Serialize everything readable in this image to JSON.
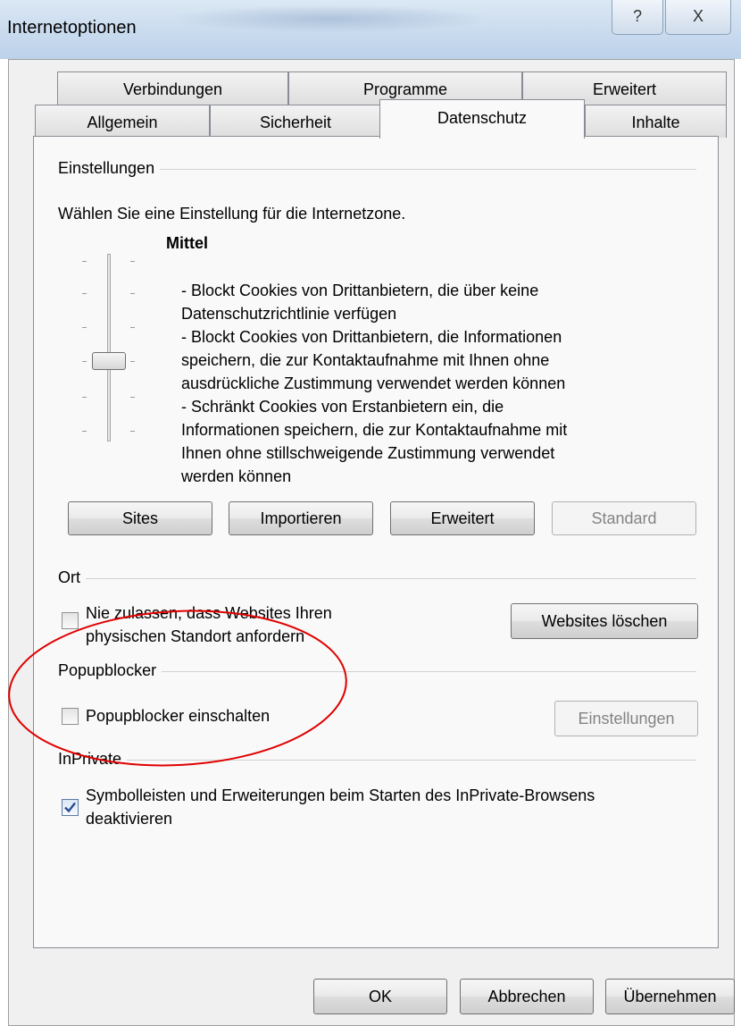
{
  "window": {
    "title": "Internetoptionen",
    "help_glyph": "?",
    "close_glyph": "X"
  },
  "tabs": {
    "row1": [
      "Verbindungen",
      "Programme",
      "Erweitert"
    ],
    "row2": [
      "Allgemein",
      "Sicherheit",
      "Datenschutz",
      "Inhalte"
    ],
    "active": "Datenschutz"
  },
  "einstellungen": {
    "header": "Einstellungen",
    "intro": "Wählen Sie eine Einstellung für die Internetzone.",
    "level_name": "Mittel",
    "slider_level": "Mittel",
    "description": [
      "- Blockt Cookies von Drittanbietern, die über keine",
      "Datenschutzrichtlinie verfügen",
      "- Blockt Cookies von Drittanbietern, die Informationen",
      "speichern, die zur Kontaktaufnahme mit Ihnen ohne",
      "ausdrückliche Zustimmung verwendet werden können",
      "- Schränkt Cookies von Erstanbietern ein, die",
      "Informationen speichern, die zur Kontaktaufnahme mit",
      "Ihnen ohne stillschweigende Zustimmung verwendet",
      "werden können"
    ],
    "buttons": {
      "sites": "Sites",
      "importieren": "Importieren",
      "erweitert": "Erweitert",
      "standard": "Standard"
    }
  },
  "ort": {
    "header": "Ort",
    "checkbox_line1": "Nie zulassen, dass Websites Ihren",
    "checkbox_line2": "physischen Standort anfordern",
    "checked": false,
    "button": "Websites löschen"
  },
  "popupblocker": {
    "header": "Popupblocker",
    "checkbox_label": "Popupblocker einschalten",
    "checked": false,
    "button": "Einstellungen"
  },
  "inprivate": {
    "header": "InPrivate",
    "checkbox_line1": "Symbolleisten und Erweiterungen beim Starten des InPrivate-Browsens",
    "checkbox_line2": "deaktivieren",
    "checked": true
  },
  "footer": {
    "ok": "OK",
    "abbrechen": "Abbrechen",
    "uebernehmen": "Übernehmen"
  },
  "colors": {
    "annotation_circle": "#e00000",
    "title_bar": "#c9dbee",
    "dialog_bg": "#f0f0f0",
    "panel_bg": "#f9f9f9"
  }
}
